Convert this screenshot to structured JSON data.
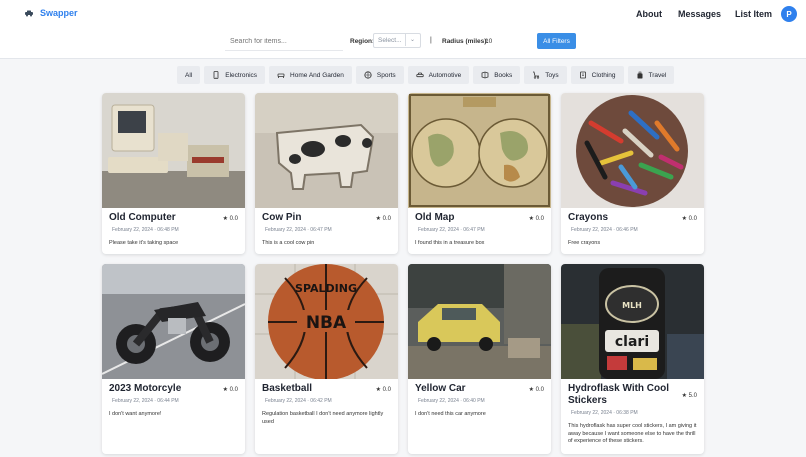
{
  "app": {
    "name": "Swapper"
  },
  "nav": {
    "about": "About",
    "messages": "Messages",
    "list_item": "List Item",
    "avatar_initial": "P"
  },
  "search": {
    "placeholder": "Search for items...",
    "region_label": "Region:",
    "region_value": "Select...",
    "radius_label": "Radius (miles):",
    "radius_value": "10",
    "filters_button": "All Filters"
  },
  "categories": [
    {
      "label": "All",
      "icon": "none"
    },
    {
      "label": "Electronics",
      "icon": "phone-icon"
    },
    {
      "label": "Home And Garden",
      "icon": "sofa-icon"
    },
    {
      "label": "Sports",
      "icon": "ball-icon"
    },
    {
      "label": "Automotive",
      "icon": "car-icon"
    },
    {
      "label": "Books",
      "icon": "books-icon"
    },
    {
      "label": "Toys",
      "icon": "stroller-icon"
    },
    {
      "label": "Clothing",
      "icon": "clothing-icon"
    },
    {
      "label": "Travel",
      "icon": "luggage-icon"
    }
  ],
  "items": [
    {
      "title": "Old Computer",
      "rating": "★ 0.0",
      "date": "February 22, 2024 · 06:48 PM",
      "description": "Please take it's taking space"
    },
    {
      "title": "Cow Pin",
      "rating": "★ 0.0",
      "date": "February 22, 2024 · 06:47 PM",
      "description": "This is a cool cow pin"
    },
    {
      "title": "Old Map",
      "rating": "★ 0.0",
      "date": "February 22, 2024 · 06:47 PM",
      "description": "I found this in a treasure box"
    },
    {
      "title": "Crayons",
      "rating": "★ 0.0",
      "date": "February 22, 2024 · 06:46 PM",
      "description": "Free crayons"
    },
    {
      "title": "2023 Motorcyle",
      "rating": "★ 0.0",
      "date": "February 22, 2024 · 06:44 PM",
      "description": "I don't want anymore!"
    },
    {
      "title": "Basketball",
      "rating": "★ 0.0",
      "date": "February 22, 2024 · 06:42 PM",
      "description": "Regulation basketball I don't need anymore lightly used"
    },
    {
      "title": "Yellow Car",
      "rating": "★ 0.0",
      "date": "February 22, 2024 · 06:40 PM",
      "description": "I don't need this car anymore"
    },
    {
      "title": "Hydroflask With Cool Stickers",
      "rating": "★ 5.0",
      "date": "February 22, 2024 · 06:38 PM",
      "description": "This hydroflask has super cool stickers, I am giving it away because I want someone else to have the thrill of experience of these stickers."
    }
  ],
  "colors": {
    "accent": "#3a8ee6",
    "brand": "#2f80ed"
  }
}
